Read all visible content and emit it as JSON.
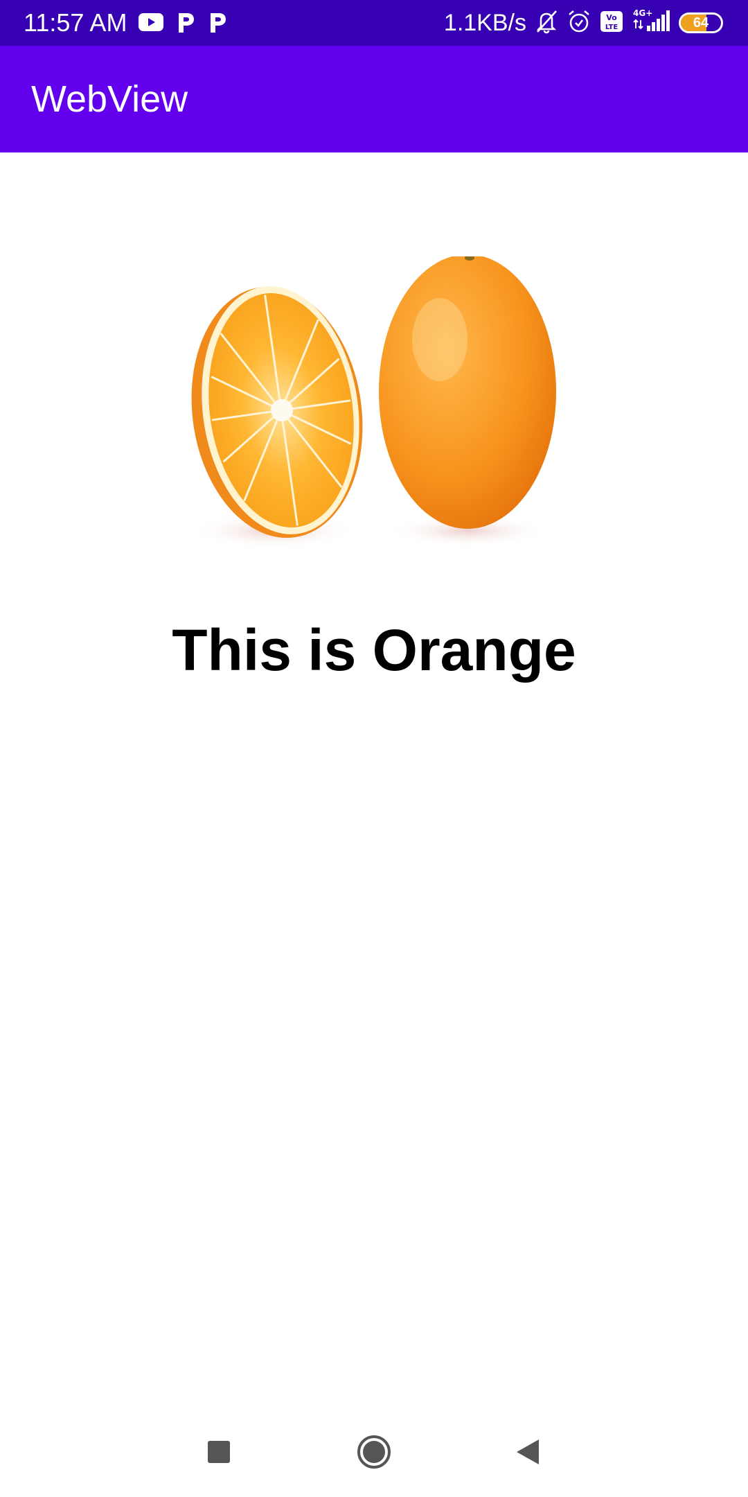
{
  "status_bar": {
    "time": "11:57 AM",
    "net_speed": "1.1KB/s",
    "network_type": "4G+",
    "volte_label": "Vo LTE",
    "battery_level": "64",
    "battery_percent": 64,
    "icons": [
      "youtube-icon",
      "p-app-icon",
      "p-app-icon",
      "bell-muted-icon",
      "alarm-icon",
      "volte-icon",
      "signal-icon",
      "battery-icon"
    ],
    "background_color": "#3700b3"
  },
  "app_bar": {
    "title": "WebView",
    "background_color": "#6200ee"
  },
  "web_content": {
    "image_alt": "orange",
    "heading": "This is Orange"
  },
  "nav_bar": {
    "buttons": [
      "recents-button",
      "home-button",
      "back-button"
    ]
  }
}
